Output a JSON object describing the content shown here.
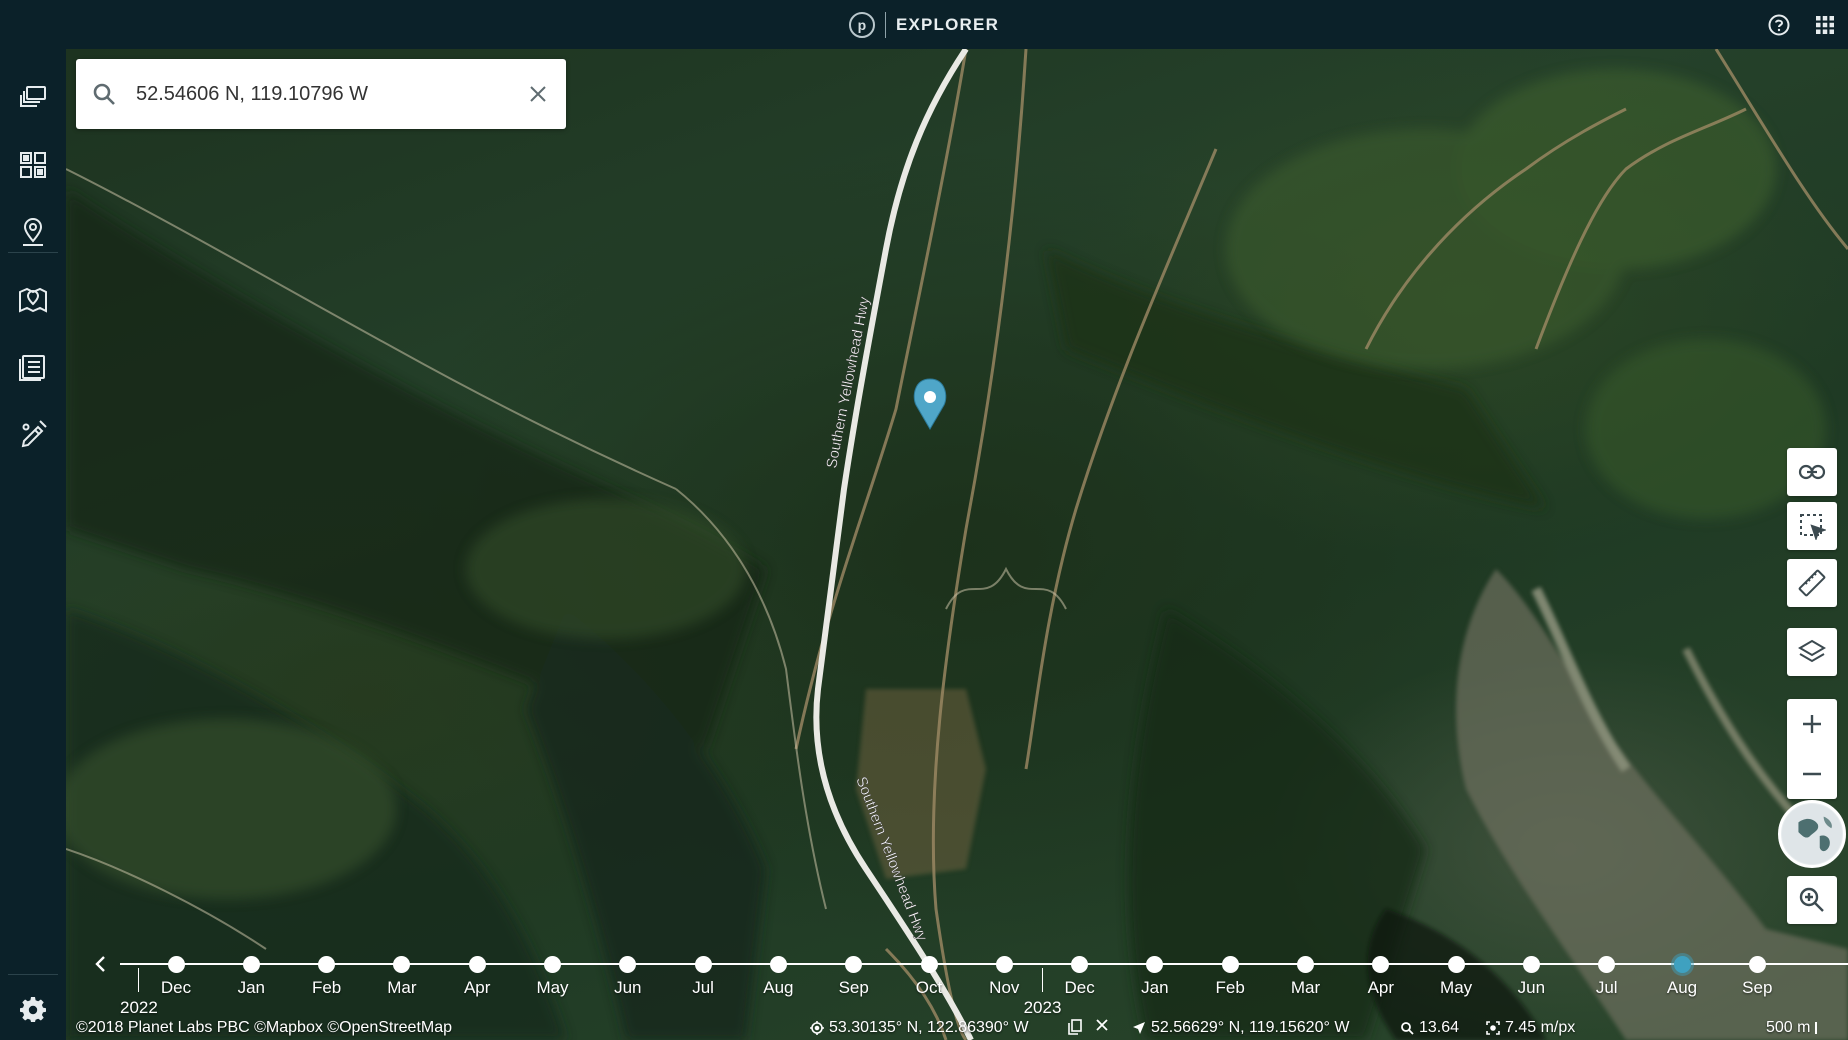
{
  "app": {
    "title": "EXPLORER",
    "logo_letter": "p"
  },
  "header": {
    "help_icon": "help-circle-icon",
    "apps_icon": "apps-grid-icon"
  },
  "sidebar": {
    "items": [
      {
        "name": "layers-stack-icon"
      },
      {
        "name": "mosaic-grid-icon"
      },
      {
        "name": "location-pin-icon"
      },
      {
        "name": "map-pin-icon"
      },
      {
        "name": "list-document-icon"
      },
      {
        "name": "draw-tools-icon"
      }
    ],
    "settings_icon": "gear-icon"
  },
  "search": {
    "value": "52.54606 N, 119.10796 W",
    "placeholder": ""
  },
  "map": {
    "road_labels": [
      "Southern Yellowhead Hwy",
      "Southern Yellowhead Hwy"
    ],
    "marker_color": "#4fa6c8"
  },
  "tools": [
    {
      "name": "link-icon"
    },
    {
      "name": "select-area-icon"
    },
    {
      "name": "ruler-icon"
    },
    {
      "name": "layers-icon"
    }
  ],
  "zoom": {
    "in_label": "+",
    "out_label": "−"
  },
  "timeline": {
    "months": [
      "Dec",
      "Jan",
      "Feb",
      "Mar",
      "Apr",
      "May",
      "Jun",
      "Jul",
      "Aug",
      "Sep",
      "Oct",
      "Nov",
      "Dec",
      "Jan",
      "Feb",
      "Mar",
      "Apr",
      "May",
      "Jun",
      "Jul",
      "Aug",
      "Sep"
    ],
    "years": [
      "2022",
      "2023"
    ],
    "active_month_index": 20,
    "accent_color": "#3fa1c0"
  },
  "status": {
    "attribution": "©2018 Planet Labs PBC ©Mapbox ©OpenStreetMap",
    "cursor_coords": "53.30135° N, 122.86390° W",
    "center_coords": "52.56629° N, 119.15620° W",
    "zoom_level": "13.64",
    "resolution": "7.45 m/px",
    "scale": "500 m"
  }
}
